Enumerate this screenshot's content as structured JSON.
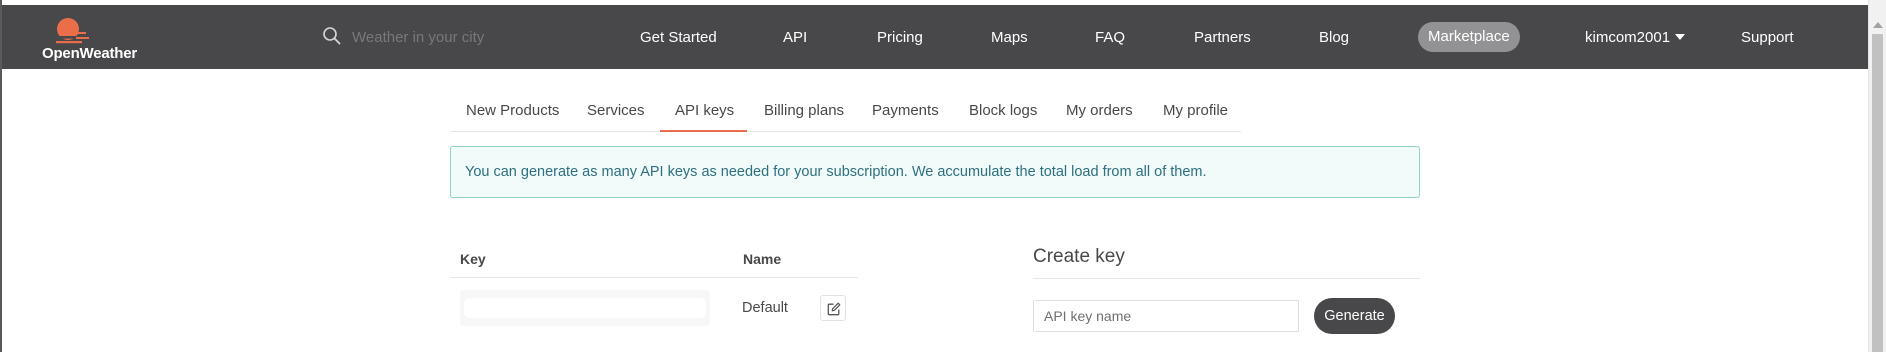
{
  "brand": {
    "name": "OpenWeather",
    "logo_color": "#eb6e4b"
  },
  "search": {
    "placeholder": "Weather in your city",
    "icon": "search-icon"
  },
  "nav": {
    "items": [
      {
        "label": "Get Started"
      },
      {
        "label": "API"
      },
      {
        "label": "Pricing"
      },
      {
        "label": "Maps"
      },
      {
        "label": "FAQ"
      },
      {
        "label": "Partners"
      },
      {
        "label": "Blog"
      },
      {
        "label": "Marketplace"
      },
      {
        "label": "kimcom2001"
      },
      {
        "label": "Support"
      }
    ],
    "active": "Marketplace"
  },
  "tabs": {
    "items": [
      {
        "label": "New Products"
      },
      {
        "label": "Services"
      },
      {
        "label": "API keys"
      },
      {
        "label": "Billing plans"
      },
      {
        "label": "Payments"
      },
      {
        "label": "Block logs"
      },
      {
        "label": "My orders"
      },
      {
        "label": "My profile"
      }
    ],
    "active": "API keys",
    "accent": "#e96e50"
  },
  "alert": {
    "text": "You can generate as many API keys as needed for your subscription. We accumulate the total load from all of them."
  },
  "keys_table": {
    "headers": {
      "key": "Key",
      "name": "Name"
    },
    "rows": [
      {
        "key": "",
        "name": "Default",
        "icon": "edit-icon"
      }
    ]
  },
  "create_key": {
    "title": "Create key",
    "input_placeholder": "API key name",
    "input_value": "",
    "button_label": "Generate"
  },
  "colors": {
    "navbar_bg": "#48484a",
    "alert_border": "#91d2c6",
    "alert_bg": "#f1fbf9",
    "alert_text": "#2e6f80"
  }
}
